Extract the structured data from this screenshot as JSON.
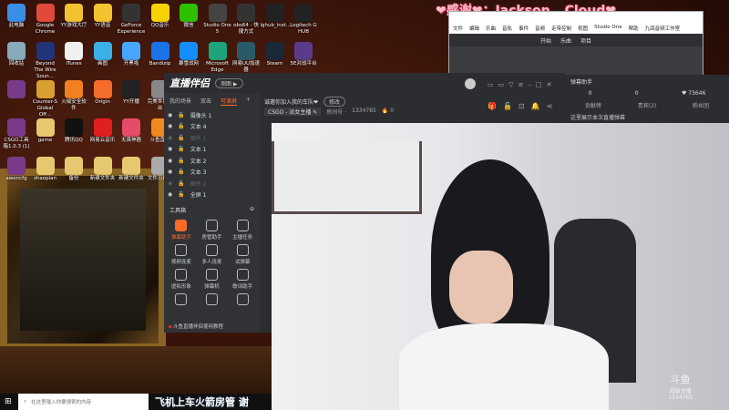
{
  "banner": "❤感谢❤：Jackson,,,Cloud❤",
  "desktop_icons": [
    {
      "label": "此电脑",
      "color": "#3a8ee6"
    },
    {
      "label": "Google Chrome",
      "color": "#e04a3a"
    },
    {
      "label": "YY游戏大厅",
      "color": "#f2c230"
    },
    {
      "label": "YY语音",
      "color": "#f2c230"
    },
    {
      "label": "GeForce Experience",
      "color": "#333"
    },
    {
      "label": "QQ音乐",
      "color": "#f5d200"
    },
    {
      "label": "微信",
      "color": "#2dc100"
    },
    {
      "label": "Studio One 5",
      "color": "#444"
    },
    {
      "label": "obs64 - 快捷方式",
      "color": "#333"
    },
    {
      "label": "lghub_inst...",
      "color": "#222"
    },
    {
      "label": "Logitech G HUB",
      "color": "#222"
    },
    {
      "label": "回收站",
      "color": "#8ab"
    },
    {
      "label": "Beyond The Wire Soun...",
      "color": "#237"
    },
    {
      "label": "iTunes",
      "color": "#f0f0f0"
    },
    {
      "label": "画图",
      "color": "#3ab0e6"
    },
    {
      "label": "开黑啦",
      "color": "#49a6ff"
    },
    {
      "label": "Bandizip",
      "color": "#1a73e8"
    },
    {
      "label": "暴雪战网",
      "color": "#148eff"
    },
    {
      "label": "Microsoft Edge",
      "color": "#1fa37a"
    },
    {
      "label": "网易UU加速器",
      "color": "#2a5a6a"
    },
    {
      "label": "Steam",
      "color": "#1b2838"
    },
    {
      "label": "5E对战平台",
      "color": "#5a3a8a"
    },
    {
      "label": "",
      "color": "#7a3a8a"
    },
    {
      "label": "Counter-S Global Off...",
      "color": "#d8a030"
    },
    {
      "label": "火绒安全软件",
      "color": "#f08020"
    },
    {
      "label": "Origin",
      "color": "#f56c2d"
    },
    {
      "label": "YY开播",
      "color": "#222"
    },
    {
      "label": "完美世界平台",
      "color": "#888"
    },
    {
      "label": "CSGO工具箱1.0.3 (1)",
      "color": "#7a3a8a"
    },
    {
      "label": "game",
      "color": "#e6c870"
    },
    {
      "label": "腾讯QQ",
      "color": "#111"
    },
    {
      "label": "网易云音乐",
      "color": "#e02020"
    },
    {
      "label": "无畏神器",
      "color": "#e84a6a"
    },
    {
      "label": "斗鱼直播",
      "color": "#f08a20"
    },
    {
      "label": "awencfg",
      "color": "#7a3a8a"
    },
    {
      "label": "zhaopian",
      "color": "#e6c870"
    },
    {
      "label": "备份",
      "color": "#e6c870"
    },
    {
      "label": "新建文件夹",
      "color": "#e6c870"
    },
    {
      "label": "新建文件夹",
      "color": "#e6c870"
    },
    {
      "label": "文件万能...",
      "color": "#aaa"
    }
  ],
  "app": {
    "logo": "直播伴侣",
    "badge": "测图 ▶",
    "tabs": [
      "我的场景",
      "双击",
      "可滚屏",
      "+"
    ],
    "sources": [
      {
        "label": "摄像头 1",
        "dim": false
      },
      {
        "label": "文本 4",
        "dim": false
      },
      {
        "label": "图片 1",
        "dim": true
      },
      {
        "label": "文本 1",
        "dim": false
      },
      {
        "label": "文本 2",
        "dim": false
      },
      {
        "label": "文本 3",
        "dim": false
      },
      {
        "label": "图片 2",
        "dim": true
      },
      {
        "label": "全屏 1",
        "dim": false
      }
    ],
    "toolbox_title": "工具箱",
    "tools": [
      "弹幕助手",
      "房管助手",
      "主播任务",
      "视频连麦",
      "多人连麦",
      "试弹幕",
      "虚拟形象",
      "弹幕机",
      "歌词助手",
      "",
      "",
      ""
    ],
    "footer": "斗鱼直播伴侣使用教程",
    "room_title": "诚邀你加入我的车队❤",
    "edit": "修改",
    "category": "CSGO - 派女主播 ✎",
    "room_label": "房间号 ·",
    "room_id": "1334765",
    "hot": "🔥 0"
  },
  "studio": {
    "menu": [
      "文件",
      "编辑",
      "乐曲",
      "音轨",
      "事件",
      "音频",
      "走带控制",
      "视图",
      "Studio One",
      "帮助",
      "九鸽音频工作室"
    ],
    "toolbar": [
      "开始",
      "乐曲",
      "项目"
    ]
  },
  "danmu": {
    "title": "弹幕助手",
    "count1": "0",
    "count2": "0",
    "likes": "♥ 73646",
    "tabs": [
      "贡献榜",
      "贵宾(2)",
      "粉丝团"
    ],
    "hint": "这里展示本次直播弹幕"
  },
  "taskbar": {
    "search_placeholder": "在这里输入你要搜索的内容"
  },
  "ticker": "飞机上车火箭房管 谢",
  "watermark": {
    "brand": "斗鱼",
    "sub": "超级主播",
    "id": "1334765"
  }
}
